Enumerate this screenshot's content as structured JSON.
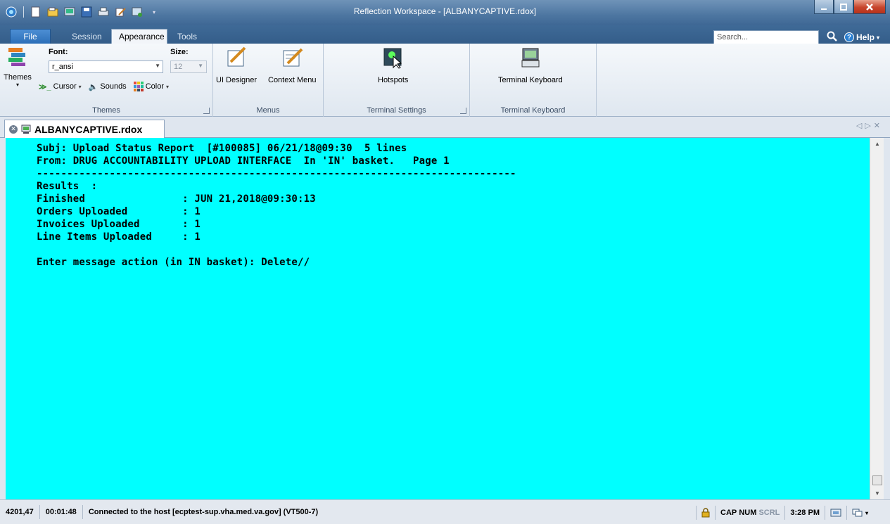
{
  "window": {
    "title": "Reflection Workspace - [ALBANYCAPTIVE.rdox]"
  },
  "ribbon_tabs": {
    "file": "File",
    "session": "Session",
    "appearance": "Appearance",
    "tools": "Tools"
  },
  "search": {
    "placeholder": "Search..."
  },
  "help": {
    "label": "Help"
  },
  "themes_group": {
    "themes_label": "Themes",
    "font_label": "Font:",
    "font_value": "r_ansi",
    "size_label": "Size:",
    "size_value": "12",
    "cursor_label": "Cursor",
    "sounds_label": "Sounds",
    "color_label": "Color",
    "group_label": "Themes"
  },
  "menus_group": {
    "ui_designer": "UI Designer",
    "context_menu": "Context Menu",
    "group_label": "Menus"
  },
  "terminal_settings_group": {
    "hotspots": "Hotspots",
    "group_label": "Terminal Settings"
  },
  "terminal_keyboard_group": {
    "terminal_keyboard": "Terminal Keyboard",
    "group_label": "Terminal Keyboard"
  },
  "document_tab": {
    "name": "ALBANYCAPTIVE.rdox"
  },
  "terminal": {
    "lines": [
      "Subj: Upload Status Report  [#100085] 06/21/18@09:30  5 lines",
      "From: DRUG ACCOUNTABILITY UPLOAD INTERFACE  In 'IN' basket.   Page 1",
      "-------------------------------------------------------------------------------",
      "Results  :",
      "Finished                : JUN 21,2018@09:30:13",
      "Orders Uploaded         : 1",
      "Invoices Uploaded       : 1",
      "Line Items Uploaded     : 1",
      "",
      "Enter message action (in IN basket): Delete//"
    ],
    "background_color": "#00ffff"
  },
  "status_bar": {
    "cursor_pos": "4201,47",
    "elapsed": "00:01:48",
    "connection": "Connected to the host [ecptest-sup.vha.med.va.gov] (VT500-7)",
    "cap": "CAP",
    "num": "NUM",
    "scrl": "SCRL",
    "time": "3:28 PM"
  }
}
